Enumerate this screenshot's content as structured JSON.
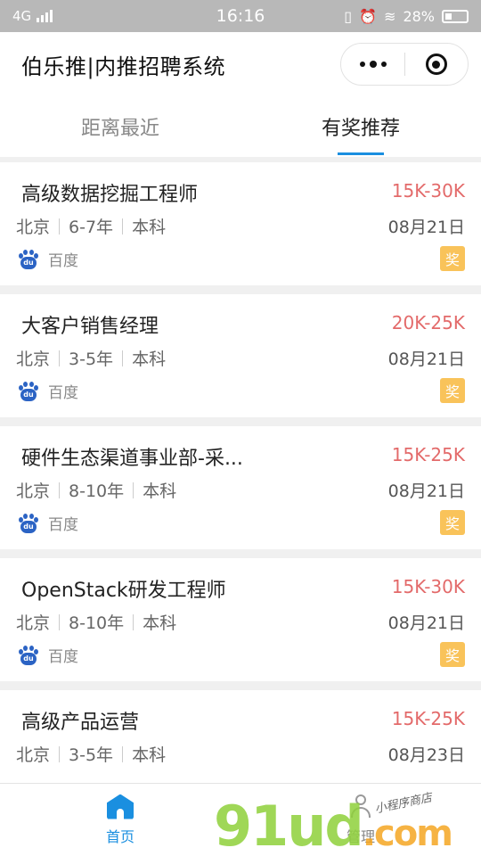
{
  "status_bar": {
    "network": "4G",
    "time": "16:16",
    "battery": "28%"
  },
  "header": {
    "title": "伯乐推|内推招聘系统"
  },
  "tabs": [
    {
      "label": "距离最近",
      "active": false
    },
    {
      "label": "有奖推荐",
      "active": true
    }
  ],
  "jobs": [
    {
      "title": "高级数据挖掘工程师",
      "salary": "15K-30K",
      "city": "北京",
      "experience": "6-7年",
      "education": "本科",
      "date": "08月21日",
      "company": "百度",
      "reward": "奖"
    },
    {
      "title": "大客户销售经理",
      "salary": "20K-25K",
      "city": "北京",
      "experience": "3-5年",
      "education": "本科",
      "date": "08月21日",
      "company": "百度",
      "reward": "奖"
    },
    {
      "title": "硬件生态渠道事业部-采...",
      "salary": "15K-25K",
      "city": "北京",
      "experience": "8-10年",
      "education": "本科",
      "date": "08月21日",
      "company": "百度",
      "reward": "奖"
    },
    {
      "title": "OpenStack研发工程师",
      "salary": "15K-30K",
      "city": "北京",
      "experience": "8-10年",
      "education": "本科",
      "date": "08月21日",
      "company": "百度",
      "reward": "奖"
    },
    {
      "title": "高级产品运营",
      "salary": "15K-25K",
      "city": "北京",
      "experience": "3-5年",
      "education": "本科",
      "date": "08月23日",
      "company": "",
      "reward": ""
    }
  ],
  "bottom_nav": [
    {
      "label": "首页",
      "icon": "home-icon",
      "active": true
    },
    {
      "label": "管理",
      "icon": "user-icon",
      "active": false
    }
  ],
  "watermark": {
    "text": "91ud",
    "suffix": ".com",
    "subtext": "小程序商店"
  },
  "colors": {
    "accent": "#1a8fe0",
    "salary": "#e36a6a",
    "reward": "#f9c35a"
  }
}
